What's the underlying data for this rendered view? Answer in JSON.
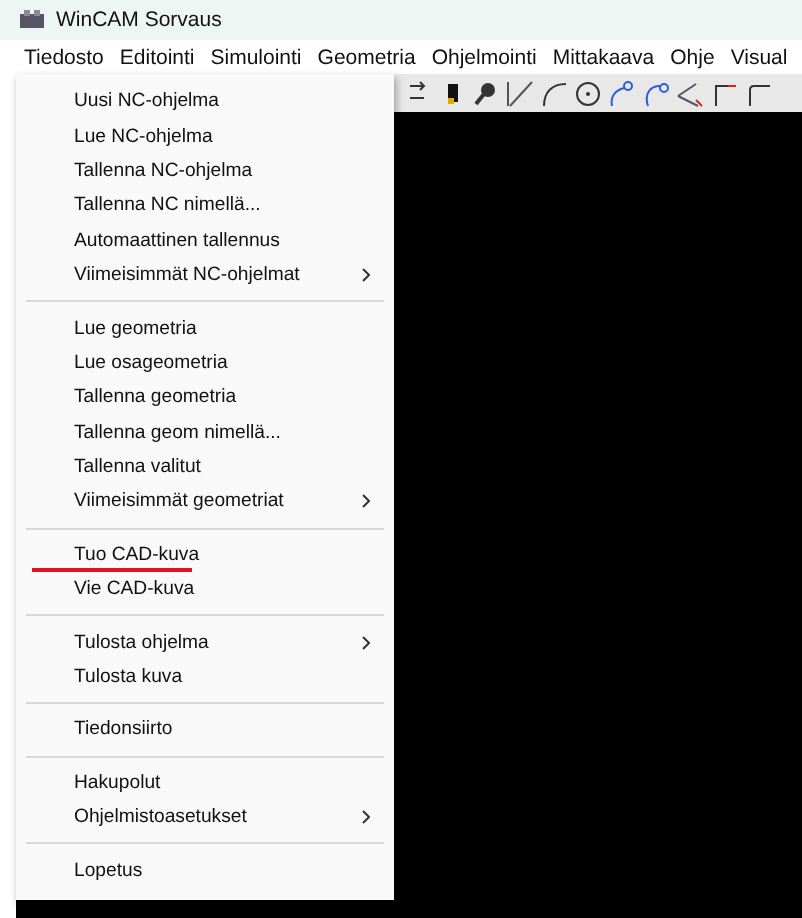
{
  "window": {
    "title": "WinCAM Sorvaus"
  },
  "menubar": [
    "Tiedosto",
    "Editointi",
    "Simulointi",
    "Geometria",
    "Ohjelmointi",
    "Mittakaava",
    "Ohje",
    "Visual"
  ],
  "dropdown": {
    "groups": [
      {
        "items": [
          {
            "label": "Uusi NC-ohjelma",
            "submenu": false,
            "marked": false
          },
          {
            "label": "Lue NC-ohjelma",
            "submenu": false,
            "marked": false
          },
          {
            "label": "Tallenna NC-ohjelma",
            "submenu": false,
            "marked": false
          },
          {
            "label": "Tallenna NC nimellä...",
            "submenu": false,
            "marked": false
          },
          {
            "label": "Automaattinen tallennus",
            "submenu": false,
            "marked": false
          },
          {
            "label": "Viimeisimmät NC-ohjelmat",
            "submenu": true,
            "marked": false
          }
        ]
      },
      {
        "items": [
          {
            "label": "Lue geometria",
            "submenu": false,
            "marked": false
          },
          {
            "label": "Lue osageometria",
            "submenu": false,
            "marked": false
          },
          {
            "label": "Tallenna geometria",
            "submenu": false,
            "marked": false
          },
          {
            "label": "Tallenna geom nimellä...",
            "submenu": false,
            "marked": false
          },
          {
            "label": "Tallenna valitut",
            "submenu": false,
            "marked": false
          },
          {
            "label": "Viimeisimmät geometriat",
            "submenu": true,
            "marked": false
          }
        ]
      },
      {
        "items": [
          {
            "label": "Tuo CAD-kuva",
            "submenu": false,
            "marked": true
          },
          {
            "label": "Vie CAD-kuva",
            "submenu": false,
            "marked": false
          }
        ]
      },
      {
        "items": [
          {
            "label": "Tulosta ohjelma",
            "submenu": true,
            "marked": false
          },
          {
            "label": "Tulosta kuva",
            "submenu": false,
            "marked": false
          }
        ]
      },
      {
        "items": [
          {
            "label": "Tiedonsiirto",
            "submenu": false,
            "marked": false
          }
        ]
      },
      {
        "items": [
          {
            "label": "Hakupolut",
            "submenu": false,
            "marked": false
          },
          {
            "label": "Ohjelmistoasetukset",
            "submenu": true,
            "marked": false
          }
        ]
      },
      {
        "items": [
          {
            "label": "Lopetus",
            "submenu": false,
            "marked": false
          }
        ]
      }
    ]
  },
  "toolbar": {
    "kind": "drawing-tools"
  }
}
